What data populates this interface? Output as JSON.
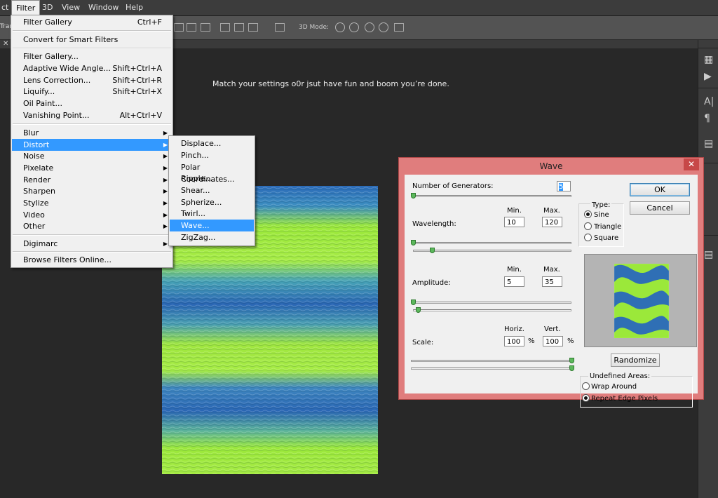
{
  "menubar": {
    "items": [
      {
        "label": "ct"
      },
      {
        "label": "Filter"
      },
      {
        "label": "3D"
      },
      {
        "label": "View"
      },
      {
        "label": "Window"
      },
      {
        "label": "Help"
      }
    ]
  },
  "options_bar": {
    "left_label": "Tran",
    "mode_label": "3D Mode:"
  },
  "canvas": {
    "note": "Match your settings o0r jsut have fun and boom you’re done."
  },
  "filter_menu": {
    "items": [
      {
        "label": "Filter Gallery",
        "shortcut": "Ctrl+F"
      },
      {
        "label": "Convert for Smart Filters",
        "shortcut": ""
      },
      {
        "label": "Filter Gallery...",
        "shortcut": ""
      },
      {
        "label": "Adaptive Wide Angle...",
        "shortcut": "Shift+Ctrl+A"
      },
      {
        "label": "Lens Correction...",
        "shortcut": "Shift+Ctrl+R"
      },
      {
        "label": "Liquify...",
        "shortcut": "Shift+Ctrl+X"
      },
      {
        "label": "Oil Paint...",
        "shortcut": ""
      },
      {
        "label": "Vanishing Point...",
        "shortcut": "Alt+Ctrl+V"
      },
      {
        "label": "Blur",
        "shortcut": ""
      },
      {
        "label": "Distort",
        "shortcut": ""
      },
      {
        "label": "Noise",
        "shortcut": ""
      },
      {
        "label": "Pixelate",
        "shortcut": ""
      },
      {
        "label": "Render",
        "shortcut": ""
      },
      {
        "label": "Sharpen",
        "shortcut": ""
      },
      {
        "label": "Stylize",
        "shortcut": ""
      },
      {
        "label": "Video",
        "shortcut": ""
      },
      {
        "label": "Other",
        "shortcut": ""
      },
      {
        "label": "Digimarc",
        "shortcut": ""
      },
      {
        "label": "Browse Filters Online...",
        "shortcut": ""
      }
    ]
  },
  "distort_menu": {
    "items": [
      {
        "label": "Displace..."
      },
      {
        "label": "Pinch..."
      },
      {
        "label": "Polar Coordinates..."
      },
      {
        "label": "Ripple..."
      },
      {
        "label": "Shear..."
      },
      {
        "label": "Spherize..."
      },
      {
        "label": "Twirl..."
      },
      {
        "label": "Wave..."
      },
      {
        "label": "ZigZag..."
      }
    ]
  },
  "wave_dialog": {
    "title": "Wave",
    "close": "✕",
    "generators_label": "Number of Generators:",
    "generators_value": "5",
    "min_label": "Min.",
    "max_label": "Max.",
    "wavelength_label": "Wavelength:",
    "wavelength_min": "10",
    "wavelength_max": "120",
    "amplitude_label": "Amplitude:",
    "amplitude_min": "5",
    "amplitude_max": "35",
    "scale_label": "Scale:",
    "horiz_label": "Horiz.",
    "vert_label": "Vert.",
    "scale_horiz": "100",
    "scale_vert": "100",
    "percent": "%",
    "type_label": "Type:",
    "type_sine": "Sine",
    "type_triangle": "Triangle",
    "type_square": "Square",
    "ok": "OK",
    "cancel": "Cancel",
    "randomize": "Randomize",
    "undefined_label": "Undefined Areas:",
    "wrap_around": "Wrap Around",
    "repeat_edge": "Repeat Edge Pixels",
    "slider_levels": {
      "generators": 0.0,
      "wavelength_min": 0.0,
      "wavelength_max": 0.12,
      "amplitude_min": 0.0,
      "amplitude_max": 0.03,
      "scale_horiz": 1.0,
      "scale_vert": 1.0
    }
  },
  "colors": {
    "menu_highlight": "#3399ff",
    "dialog_frame": "#e07d7d",
    "image_blue": "#2f6fb5",
    "image_green": "#9be83a"
  }
}
